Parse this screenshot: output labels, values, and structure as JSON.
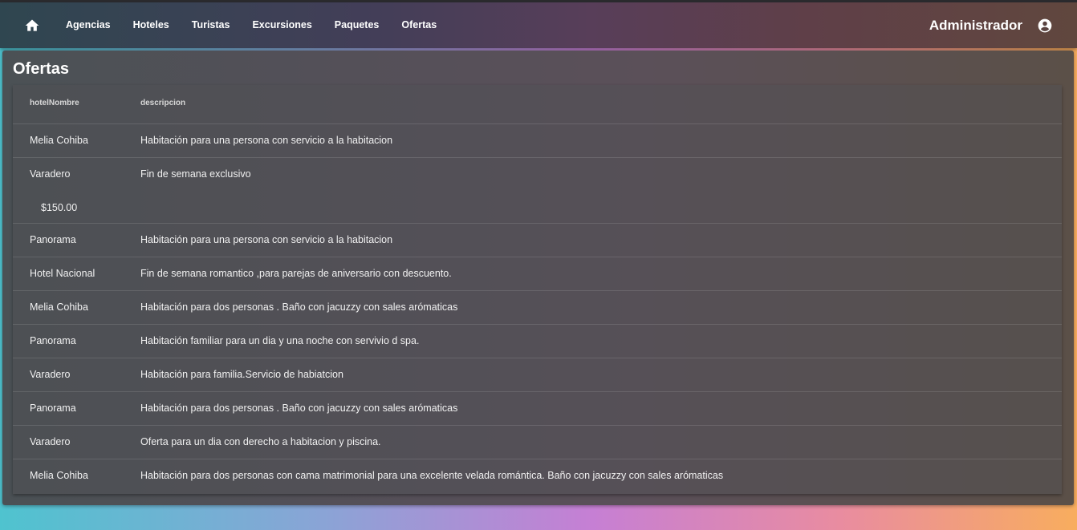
{
  "nav": {
    "items": [
      {
        "label": "Agencias"
      },
      {
        "label": "Hoteles"
      },
      {
        "label": "Turistas"
      },
      {
        "label": "Excursiones"
      },
      {
        "label": "Paquetes"
      },
      {
        "label": "Ofertas"
      }
    ],
    "user_name": "Administrador",
    "icons": {
      "home": "home-icon",
      "user": "account-circle-icon"
    }
  },
  "page": {
    "title": "Ofertas"
  },
  "table": {
    "columns": [
      "hotelNombre",
      "descripcion"
    ],
    "rows": [
      {
        "hotel": "Melia Cohiba",
        "descripcion": "Habitación para una persona con servicio a la habitacion"
      },
      {
        "hotel": "Varadero",
        "descripcion": "Fin de semana exclusivo",
        "price": "$150.00"
      },
      {
        "hotel": "Panorama",
        "descripcion": "Habitación para una persona con servicio a la habitacion"
      },
      {
        "hotel": "Hotel Nacional",
        "descripcion": "Fin de semana romantico ,para parejas de aniversario con descuento."
      },
      {
        "hotel": "Melia Cohiba",
        "descripcion": "Habitación para dos personas . Baño con jacuzzy con sales arómaticas"
      },
      {
        "hotel": "Panorama",
        "descripcion": "Habitación familiar para un dia y una noche con servivio d spa."
      },
      {
        "hotel": "Varadero",
        "descripcion": "Habitación para familia.Servicio de habiatcion"
      },
      {
        "hotel": "Panorama",
        "descripcion": "Habitación para dos personas . Baño con jacuzzy con sales arómaticas"
      },
      {
        "hotel": "Varadero",
        "descripcion": "Oferta para un dia con derecho a habitacion y piscina."
      },
      {
        "hotel": "Melia Cohiba",
        "descripcion": "Habitación para dos personas con cama matrimonial para una excelente velada romántica. Baño con jacuzzy con sales arómaticas"
      }
    ]
  }
}
